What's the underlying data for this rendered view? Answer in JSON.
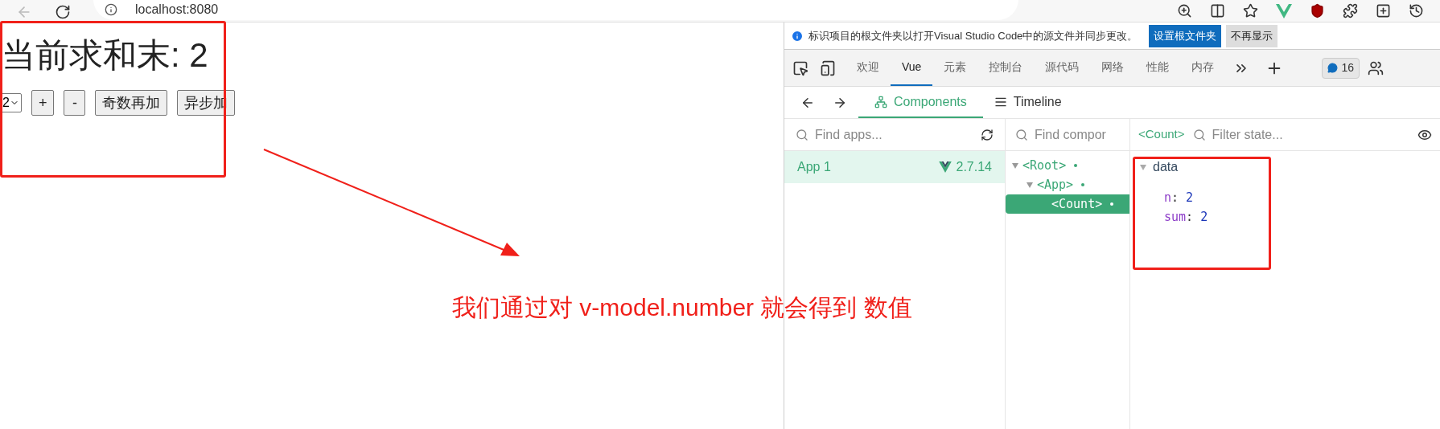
{
  "browser": {
    "address": "localhost:8080"
  },
  "page": {
    "heading": "当前求和末: 2",
    "select_value": "2",
    "buttons": [
      "+",
      "-",
      "奇数再加",
      "异步加"
    ]
  },
  "devtools": {
    "infobar": {
      "message": "标识项目的根文件夹以打开Visual Studio Code中的源文件并同步更改。",
      "buttons": [
        {
          "label": "设置根文件夹",
          "kind": "primary"
        },
        {
          "label": "不再显示",
          "kind": "secondary"
        }
      ]
    },
    "tabs": [
      {
        "label": "欢迎",
        "selected": false
      },
      {
        "label": "Vue",
        "selected": true
      },
      {
        "label": "元素",
        "selected": false
      },
      {
        "label": "控制台",
        "selected": false
      },
      {
        "label": "源代码",
        "selected": false
      },
      {
        "label": "网络",
        "selected": false
      },
      {
        "label": "性能",
        "selected": false
      },
      {
        "label": "内存",
        "selected": false
      }
    ],
    "issues_count": "16",
    "subtabs": [
      {
        "label": "Components",
        "selected": true
      },
      {
        "label": "Timeline",
        "selected": false
      }
    ],
    "apps_search": {
      "placeholder": "Find apps..."
    },
    "apps": [
      {
        "name": "App 1",
        "version": "2.7.14",
        "selected": true
      }
    ],
    "tree_search": {
      "placeholder": "Find compor"
    },
    "tree": [
      {
        "label": "<Root>",
        "selected": false,
        "expanded": true,
        "children": [
          {
            "label": "<App>",
            "selected": false,
            "expanded": true,
            "children": [
              {
                "label": "<Count>",
                "selected": true
              }
            ]
          }
        ]
      }
    ],
    "state": {
      "component": "<Count>",
      "filter_placeholder": "Filter state...",
      "sections": [
        {
          "name": "data",
          "expanded": true,
          "fields": [
            {
              "key": "n",
              "separator": ":",
              "value": "2"
            },
            {
              "key": "sum",
              "separator": ":",
              "value": "2"
            }
          ]
        }
      ]
    }
  },
  "annotation": {
    "text": "我们通过对 v-model.number 就会得到 数值"
  }
}
